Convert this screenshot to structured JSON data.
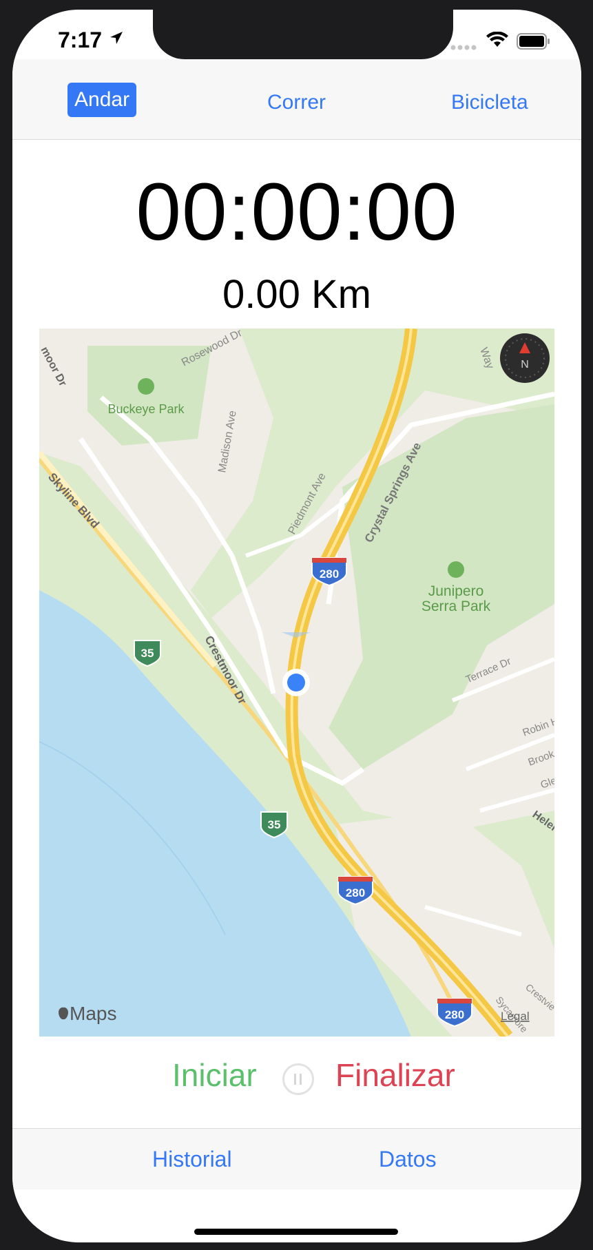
{
  "status": {
    "time": "7:17"
  },
  "segments": {
    "walk": "Andar",
    "run": "Correr",
    "bike": "Bicicleta"
  },
  "timer": "00:00:00",
  "distance": "0.00 Km",
  "map": {
    "labels": {
      "buckeye_park": "Buckeye Park",
      "rosewood": "Rosewood Dr",
      "madison": "Madison Ave",
      "piedmont": "Piedmont Ave",
      "crystal": "Crystal Springs Ave",
      "skyline": "Skyline Blvd",
      "crestmoor": "Crestmoor Dr",
      "junipero1": "Junipero",
      "junipero2": "Serra Park",
      "terrace": "Terrace Dr",
      "robin": "Robin H",
      "brook": "Brook",
      "gle": "Gle",
      "helen": "Helen",
      "crestview": "Crestvie",
      "sycamore": "Sycamore",
      "moor": "moor Dr",
      "way": "Way",
      "i280a": "280",
      "i280b": "280",
      "i280c": "280",
      "r35a": "35",
      "r35b": "35",
      "compass": "N",
      "attribution": "Maps",
      "legal": "Legal"
    }
  },
  "controls": {
    "start": "Iniciar",
    "finish": "Finalizar"
  },
  "tabs": {
    "history": "Historial",
    "data": "Datos"
  }
}
